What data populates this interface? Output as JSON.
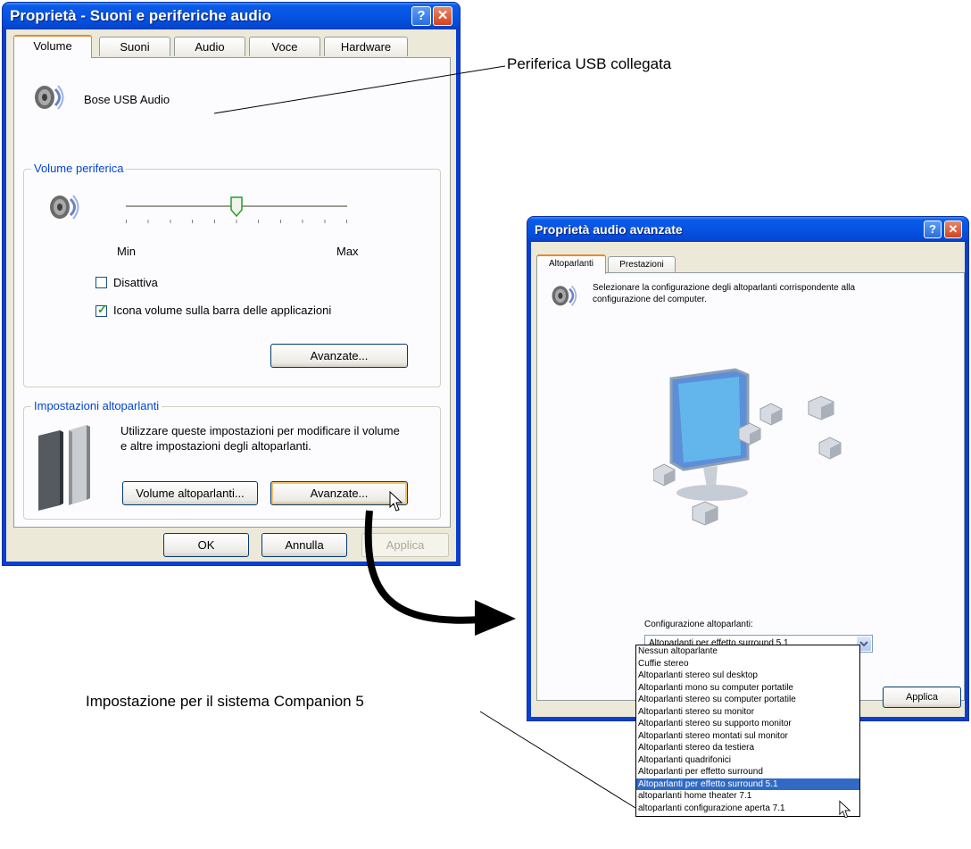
{
  "dialog1": {
    "title": "Proprietà - Suoni e periferiche audio",
    "tabs": [
      "Volume",
      "Suoni",
      "Audio",
      "Voce",
      "Hardware"
    ],
    "device_name": "Bose USB Audio",
    "volume_group": {
      "legend": "Volume periferica",
      "min_label": "Min",
      "max_label": "Max",
      "slider_level": 0.5,
      "mute_label": "Disattiva",
      "mute_checked": false,
      "taskbar_icon_label": "Icona volume sulla barra delle applicazioni",
      "taskbar_icon_checked": true,
      "advanced_button": "Avanzate..."
    },
    "speaker_group": {
      "legend": "Impostazioni altoparlanti",
      "description": "Utilizzare queste impostazioni per modificare il volume e altre impostazioni degli altoparlanti.",
      "volume_button": "Volume altoparlanti...",
      "advanced_button": "Avanzate..."
    },
    "ok_button": "OK",
    "cancel_button": "Annulla",
    "apply_button": "Applica"
  },
  "dialog2": {
    "title": "Proprietà audio avanzate",
    "tabs": [
      "Altoparlanti",
      "Prestazioni"
    ],
    "description": "Selezionare la configurazione degli altoparlanti corrispondente alla configurazione del computer.",
    "config_label": "Configurazione altoparlanti:",
    "config_selected": "Altoparlanti per effetto surround 5.1",
    "apply_button": "Applica",
    "options": [
      "Nessun altoparlante",
      "Cuffie stereo",
      "Altoparlanti stereo sul desktop",
      "Altoparlanti mono su computer portatile",
      "Altoparlanti stereo su computer portatile",
      "Altoparlanti stereo su monitor",
      "Altoparlanti stereo su supporto monitor",
      "Altoparlanti stereo montati sul monitor",
      "Altoparlanti stereo da testiera",
      "Altoparlanti quadrifonici",
      "Altoparlanti per effetto surround",
      "Altoparlanti per effetto surround 5.1",
      "altoparlanti home theater 7.1",
      "altoparlanti configurazione aperta 7.1"
    ],
    "highlighted_index": 11
  },
  "annotations": {
    "usb_label": "Periferica USB collegata",
    "companion_label": "Impostazione per il sistema Companion 5"
  },
  "colors": {
    "titlebar_blue": "#0654e3",
    "dialog_bg": "#ece9d8",
    "selection_blue": "#316ac5"
  }
}
